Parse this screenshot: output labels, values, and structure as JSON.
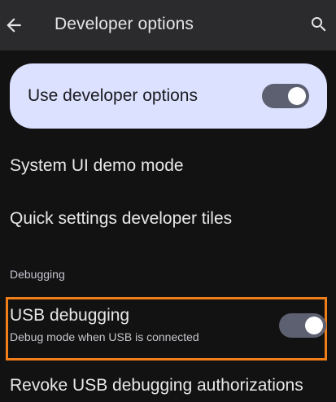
{
  "topbar": {
    "title": "Developer options",
    "back_icon": "arrow-back-icon",
    "search_icon": "search-icon"
  },
  "main_toggle": {
    "label": "Use developer options",
    "state": "on"
  },
  "rows": [
    {
      "label": "System UI demo mode"
    },
    {
      "label": "Quick settings developer tiles"
    }
  ],
  "section": {
    "header": "Debugging"
  },
  "usb_debugging": {
    "title": "USB debugging",
    "summary": "Debug mode when USB is connected",
    "state": "on"
  },
  "revoke": {
    "label": "Revoke USB debugging authorizations"
  },
  "colors": {
    "background": "#121212",
    "topbar": "#2b2b2d",
    "card": "#dbe1ff",
    "toggle_track": "#5d6071",
    "highlight": "#f07e19"
  }
}
